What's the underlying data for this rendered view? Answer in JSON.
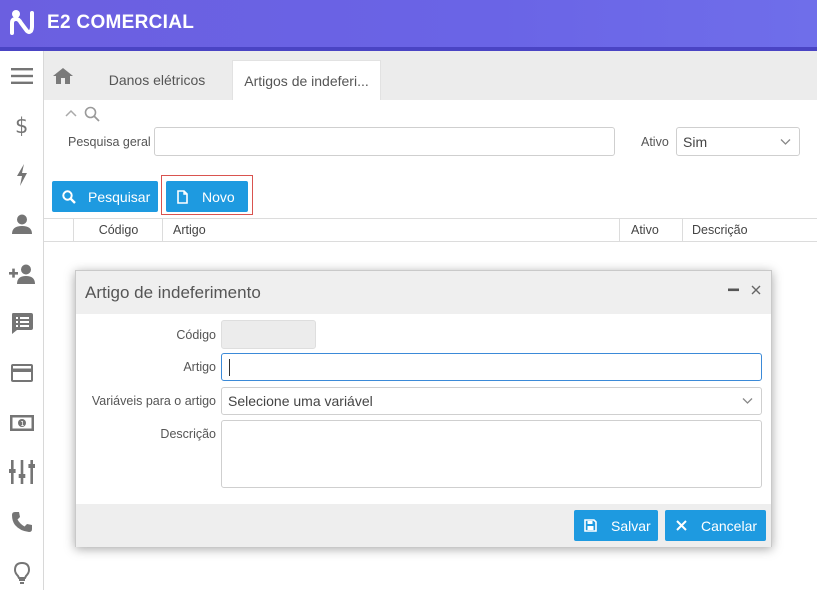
{
  "app": {
    "title": "E2 COMERCIAL"
  },
  "tabs": [
    {
      "label": "Danos elétricos"
    },
    {
      "label": "Artigos de indeferi..."
    }
  ],
  "filters": {
    "search_label": "Pesquisa geral",
    "search_value": "",
    "ativo_label": "Ativo",
    "ativo_value": "Sim"
  },
  "buttons": {
    "pesquisar": "Pesquisar",
    "novo": "Novo"
  },
  "grid": {
    "columns": [
      "Código",
      "Artigo",
      "Ativo",
      "Descrição"
    ]
  },
  "modal": {
    "title": "Artigo de indeferimento",
    "codigo_label": "Código",
    "codigo_value": "",
    "artigo_label": "Artigo",
    "artigo_value": "",
    "variaveis_label": "Variáveis para o artigo",
    "variaveis_value": "Selecione uma variável",
    "descricao_label": "Descrição",
    "descricao_value": "",
    "salvar": "Salvar",
    "cancelar": "Cancelar"
  },
  "sidebar_icons": [
    "menu-icon",
    "dollar-icon",
    "bolt-icon",
    "user-icon",
    "add-user-icon",
    "list-icon",
    "card-icon",
    "money-icon",
    "equalizer-icon",
    "phone-icon",
    "bulb-icon"
  ],
  "colors": {
    "header": "#6a64e6",
    "header_line": "#4a44c4",
    "primary_button": "#1e9ae0",
    "focus_border": "#3b8ad8",
    "novo_outline": "#d9534f"
  }
}
